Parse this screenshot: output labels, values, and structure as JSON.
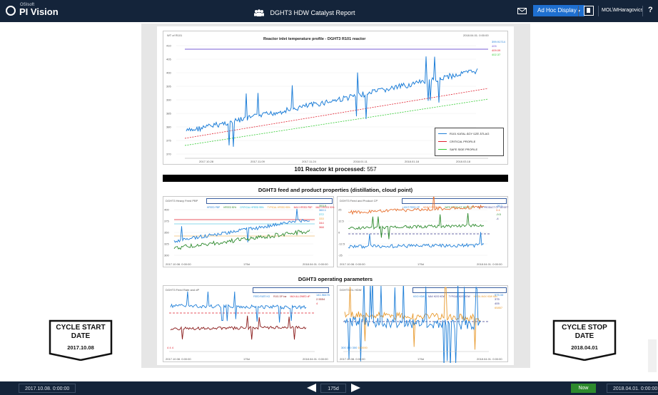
{
  "app": {
    "vendor_small": "OSIsoft",
    "name": "PI Vision"
  },
  "header": {
    "title": "DGHT3 HDW Catalyst Report",
    "display_button": "Ad Hoc Display",
    "user": "MOL\\MHaragovics",
    "help": "?"
  },
  "chart1": {
    "title": "Reactor inlet temperature profile - DGHT3 R101 reactor",
    "corner_left": "WT of R101",
    "corner_right": "2018.04.01. 0:00:00",
    "y_ticks": [
      "410",
      "405",
      "400",
      "395",
      "390",
      "385",
      "380",
      "375",
      "370"
    ],
    "x_ticks": [
      "2017.10.28",
      "2017.11.09",
      "2017.11.24",
      "2018.01.11",
      "2018.01.18",
      "2018.03.18"
    ],
    "right_values": [
      "399.91714",
      "405",
      "409.09",
      "402.37"
    ],
    "legend": [
      "R101 KATAL ÁGY ÜZE ÁTLAG",
      "CRITICAL PROFILE",
      "SAFE SIDE PROFILE"
    ],
    "colors": {
      "actual": "#1f7fd8",
      "critical": "#e0202e",
      "safe": "#33cc33",
      "top": "#7a5cd6"
    }
  },
  "kt": {
    "label": "101 Reactor kt processed:",
    "value": "557"
  },
  "section2": "DGHT3 feed and product properties (distillation, cloud point)",
  "chart2": {
    "title": "DGHT3 Heavy Feed PBP",
    "legend": [
      "HFEED PBP",
      "HFEED 90%",
      "CRITICAL HFEED 95%",
      "TYPICAL HFEED 95%",
      "MAX HFEED PBP",
      "MAX HFEED 90%"
    ],
    "right_values": [
      "353.9",
      "360.1",
      "372",
      "333",
      "344",
      "368"
    ],
    "y_ticks": [
      "400",
      "375",
      "350",
      "325",
      "300"
    ],
    "x_start": "2017.10.08. 0:00:00",
    "x_mid": "175d",
    "x_end": "2018.04.01. 0:00:00"
  },
  "chart3": {
    "title": "DGHT3 Feed and Product CP",
    "legend": [
      "LIGHT FEED CP",
      "HEAVY FEED CP",
      "WIFE PRODUCT 680KG CP",
      "WIFE PRODUCT CP TARGET"
    ],
    "right_values": [
      "-20.1",
      "3.4",
      "-9.5",
      "-4"
    ],
    "y_ticks": [
      "25",
      "12.5",
      "0",
      "-12.5",
      "-25"
    ],
    "x_start": "2017.10.08. 0:00:00",
    "x_mid": "175d",
    "x_end": "2018.04.01. 0:00:00"
  },
  "section3": "DGHT3 operating parameters",
  "chart4": {
    "title": "DGHT3 Feed Rate and dP",
    "legend": [
      "FEED RATE KG",
      "R101 DP bar",
      "MAX ALLOWED dP"
    ],
    "right_values": [
      "141.96475",
      "2.5554",
      "4"
    ],
    "bottom_values": [
      "4",
      "4",
      "4"
    ],
    "x_start": "2017.10.08. 0:00:00",
    "x_mid": "175d",
    "x_end": "2018.04.01. 0:00:00"
  },
  "chart5": {
    "title": "DGHT3 GL HDW",
    "legend": [
      "H2/O HDW",
      "MAX H2/O HDW",
      "TYPICAL H2/O HDW",
      "H2/OIL MAX HDW MIN"
    ],
    "right_values": [
      "575.33",
      "375",
      "405",
      "65857"
    ],
    "bottom_values": [
      "300",
      "300",
      "300",
      "100000"
    ],
    "x_start": "2017.10.08. 0:00:00",
    "x_mid": "175d",
    "x_end": "2018.04.01. 0:00:00"
  },
  "cycle_start": {
    "label_1": "CYCLE START",
    "label_2": "DATE",
    "date": "2017.10.08"
  },
  "cycle_stop": {
    "label_1": "CYCLE STOP",
    "label_2": "DATE",
    "date": "2018.04.01"
  },
  "timebar": {
    "start": "2017.10.08. 0:00:00",
    "duration": "175d",
    "now": "Now",
    "end": "2018.04.01. 0:00:00"
  }
}
